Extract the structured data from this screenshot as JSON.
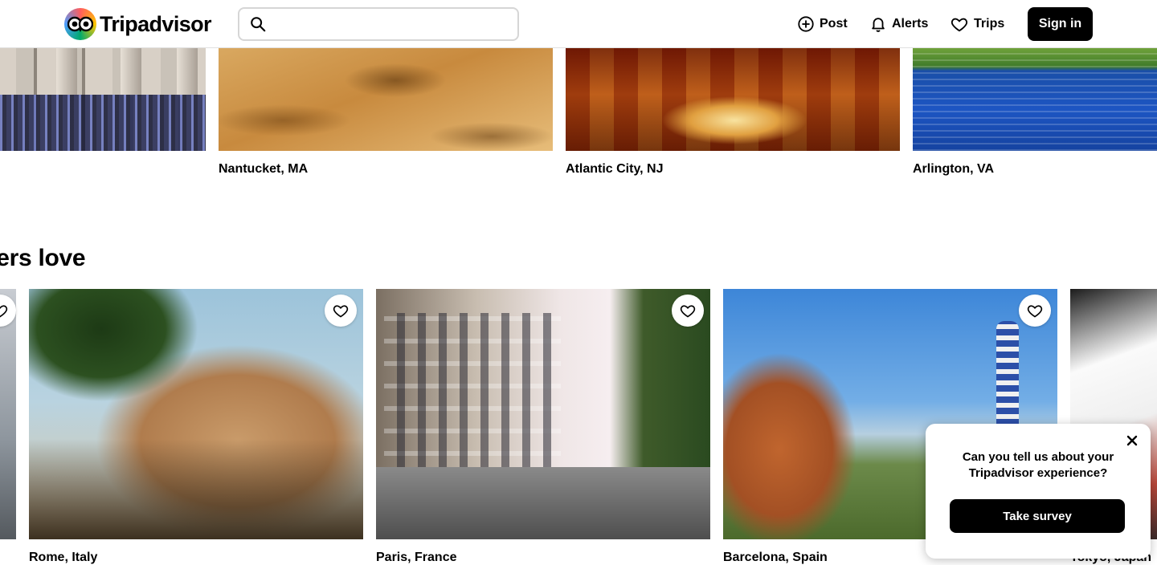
{
  "header": {
    "logo_text": "Tripadvisor",
    "search": {
      "placeholder": "",
      "value": ""
    },
    "nav": [
      {
        "label": "Post",
        "icon": "plus-circle-icon"
      },
      {
        "label": "Alerts",
        "icon": "bell-icon"
      },
      {
        "label": "Trips",
        "icon": "heart-icon"
      }
    ],
    "signin_label": "Sign in"
  },
  "top_cards": [
    {
      "label": ""
    },
    {
      "label": "Nantucket, MA"
    },
    {
      "label": "Atlantic City, NJ"
    },
    {
      "label": "Arlington, VA"
    }
  ],
  "section": {
    "title": "Top destinations travelers love",
    "cards": [
      {
        "label": "Rome, Italy"
      },
      {
        "label": "Paris, France"
      },
      {
        "label": "Barcelona, Spain"
      },
      {
        "label": "Tokyo, Japan"
      }
    ]
  },
  "survey": {
    "question": "Can you tell us about your Tripadvisor experience?",
    "button_label": "Take survey"
  },
  "colors": {
    "primary": "#000000",
    "text": "#000000",
    "border": "#d6d6d6"
  }
}
